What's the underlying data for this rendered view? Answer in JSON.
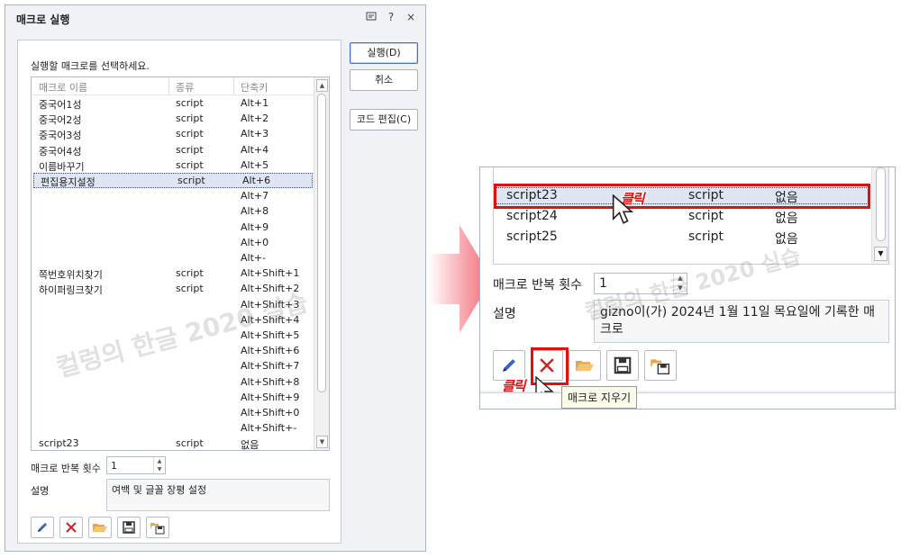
{
  "dialog": {
    "title": "매크로 실행",
    "title_icons": [
      "restore-icon",
      "help-icon",
      "close-icon"
    ],
    "help_glyph": "?",
    "close_glyph": "×",
    "prompt": "실행할 매크로를 선택하세요.",
    "columns": [
      "매크로 이름",
      "종류",
      "단축키"
    ],
    "rows": [
      {
        "name": "중국어1성",
        "type": "script",
        "key": "Alt+1"
      },
      {
        "name": "중국어2성",
        "type": "script",
        "key": "Alt+2"
      },
      {
        "name": "중국어3성",
        "type": "script",
        "key": "Alt+3"
      },
      {
        "name": "중국어4성",
        "type": "script",
        "key": "Alt+4"
      },
      {
        "name": "이름바꾸기",
        "type": "script",
        "key": "Alt+5"
      },
      {
        "name": "편집용지설정",
        "type": "script",
        "key": "Alt+6",
        "selected": true
      },
      {
        "name": "",
        "type": "",
        "key": "Alt+7"
      },
      {
        "name": "",
        "type": "",
        "key": "Alt+8"
      },
      {
        "name": "",
        "type": "",
        "key": "Alt+9"
      },
      {
        "name": "",
        "type": "",
        "key": "Alt+0"
      },
      {
        "name": "",
        "type": "",
        "key": "Alt+-"
      },
      {
        "name": "쪽번호위치찾기",
        "type": "script",
        "key": "Alt+Shift+1"
      },
      {
        "name": "하이퍼링크찾기",
        "type": "script",
        "key": "Alt+Shift+2"
      },
      {
        "name": "",
        "type": "",
        "key": "Alt+Shift+3"
      },
      {
        "name": "",
        "type": "",
        "key": "Alt+Shift+4"
      },
      {
        "name": "",
        "type": "",
        "key": "Alt+Shift+5"
      },
      {
        "name": "",
        "type": "",
        "key": "Alt+Shift+6"
      },
      {
        "name": "",
        "type": "",
        "key": "Alt+Shift+7"
      },
      {
        "name": "",
        "type": "",
        "key": "Alt+Shift+8"
      },
      {
        "name": "",
        "type": "",
        "key": "Alt+Shift+9"
      },
      {
        "name": "",
        "type": "",
        "key": "Alt+Shift+0"
      },
      {
        "name": "",
        "type": "",
        "key": "Alt+Shift+-"
      },
      {
        "name": "script23",
        "type": "script",
        "key": "없음"
      }
    ],
    "repeat_label": "매크로 반복 횟수",
    "repeat_value": "1",
    "desc_label": "설명",
    "desc_value": "여백 및 글꼴 장평 설정",
    "buttons": {
      "run": "실행(D)",
      "cancel": "취소",
      "edit_code": "코드 편집(C)"
    },
    "tool_icons": [
      "pencil-icon",
      "delete-x-icon",
      "folder-open-icon",
      "save-icon",
      "save-as-icon"
    ]
  },
  "zoom": {
    "rows": [
      {
        "name": "script23",
        "type": "script",
        "key": "없음",
        "selected": true
      },
      {
        "name": "script24",
        "type": "script",
        "key": "없음"
      },
      {
        "name": "script25",
        "type": "script",
        "key": "없음"
      }
    ],
    "repeat_label": "매크로 반복 횟수",
    "repeat_value": "1",
    "desc_label": "설명",
    "desc_value": "gizno이(가) 2024년 1월 11일 목요일에 기록한 매크로",
    "tooltip": "매크로 지우기",
    "click_label": "클릭",
    "click_label_2": "클릭"
  },
  "watermark": "컬렁의 한글 2020 실습",
  "colors": {
    "highlight_red": "#e01010",
    "selection_bg": "#dfe5f3",
    "arrow_pink": "#f26a78",
    "primary_border": "#4a6fb5"
  }
}
